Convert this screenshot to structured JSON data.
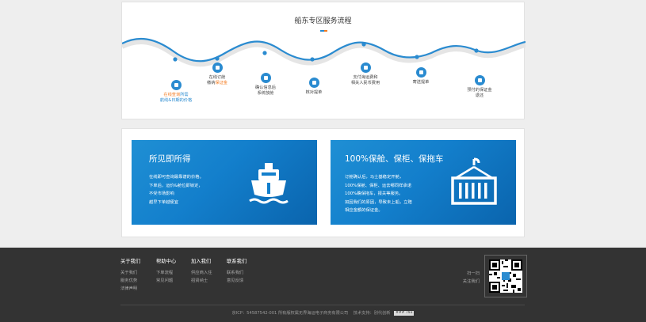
{
  "process": {
    "title": "船东专区服务流程",
    "steps": [
      {
        "icon": "calendar-icon",
        "line1_a": "在线查询",
        "line1_b": "所需",
        "line2": "航线&日期的价格"
      },
      {
        "icon": "shield-icon",
        "line1": "在线订舱",
        "line2_a": "缴纳",
        "line2_b": "保证金"
      },
      {
        "icon": "document-icon",
        "line1": "确认信息后",
        "line2": "系统放舱"
      },
      {
        "icon": "clipboard-icon",
        "line1": "核对提单"
      },
      {
        "icon": "wallet-icon",
        "line1": "支付海运费和",
        "line2": "相关人民币费用"
      },
      {
        "icon": "mail-icon",
        "line1": "寄送提单"
      },
      {
        "icon": "shield-check-icon",
        "line1": "预付的保证金",
        "line2": "退还"
      }
    ]
  },
  "features": {
    "left": {
      "title": "所见即所得",
      "lines": [
        "在线即可查询最靠谱的价格。",
        "下单后，运价&舱位即锁定，",
        "不受市场影响",
        "越早下单越便宜"
      ],
      "icon": "ship-icon"
    },
    "right": {
      "title": "100%保舱、保柜、保拖车",
      "lines": [
        "订舱确认后，马士基稳定开舱，",
        "100%保舱、保柜、运去哪同样承诺",
        "100%确保拖车，报关等服务。",
        "如因我们的原因，导致未上船，立赔",
        "相应金额的保证金。"
      ],
      "icon": "container-icon"
    }
  },
  "footer": {
    "columns": [
      {
        "heading": "关于我们",
        "items": [
          "关于我们",
          "服务优势",
          "法律声明"
        ]
      },
      {
        "heading": "帮助中心",
        "items": [
          "下单流程",
          "常见问题"
        ]
      },
      {
        "heading": "加入我们",
        "items": [
          "供应商入住",
          "招贤纳士"
        ]
      },
      {
        "heading": "联系我们",
        "items": [
          "联系我们",
          "意见反馈"
        ]
      }
    ],
    "scan_line1": "扫一扫",
    "scan_line2": "关注我们",
    "copyright": "京ICP：54587542-001 所有版权属无界海运电子商务有限公司",
    "tech_support": "技术支持：别代创新",
    "badge": "### 793"
  }
}
